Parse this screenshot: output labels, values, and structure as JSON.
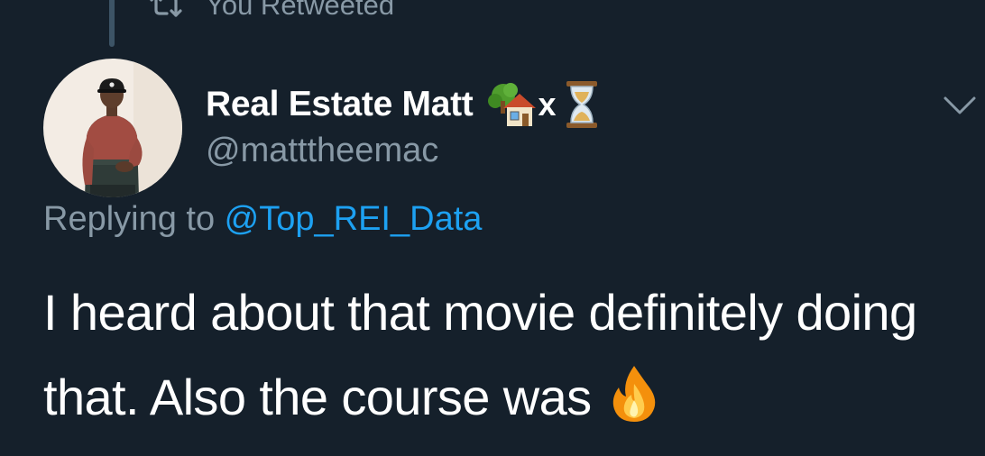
{
  "retweet_context": {
    "label": "You Retweeted",
    "icon": "retweet-icon"
  },
  "tweet": {
    "author": {
      "display_name": "Real Estate Matt",
      "name_suffix": "x",
      "name_emojis": [
        "house-with-garden-icon",
        "hourglass-icon"
      ],
      "handle": "@matttheemac",
      "avatar": "avatar"
    },
    "reply": {
      "prefix": "Replying to ",
      "mention": "@Top_REI_Data"
    },
    "text": "I heard about that movie definitely doing that. Also the course was",
    "trailing_emoji": "fire-icon",
    "menu_icon": "chevron-down-icon"
  },
  "theme": {
    "background": "#15202b",
    "primary_text": "#ffffff",
    "secondary_text": "#8899a6",
    "link": "#1da1f2"
  }
}
